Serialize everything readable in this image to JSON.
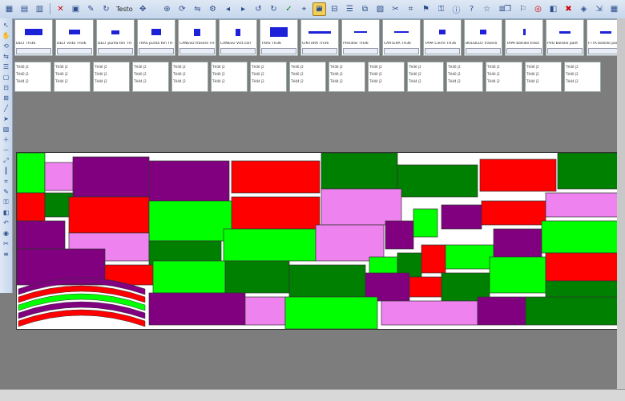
{
  "toolbar": {
    "text_label": "Testo"
  },
  "pieces": [
    {
      "label": "DELT TH36",
      "w": 22,
      "h": 8
    },
    {
      "label": "DELT vista TH36",
      "w": 14,
      "h": 6
    },
    {
      "label": "DELT punta ten TH",
      "w": 10,
      "h": 5
    },
    {
      "label": "TRAS punta ten TH",
      "w": 12,
      "h": 8
    },
    {
      "label": "CANESU trasero TH",
      "w": 8,
      "h": 9
    },
    {
      "label": "CANESU Vist carr",
      "w": 6,
      "h": 9
    },
    {
      "label": "TRAS TH36",
      "w": 22,
      "h": 12
    },
    {
      "label": "CINTURA TH36",
      "w": 28,
      "h": 3
    },
    {
      "label": "Presillas TH36",
      "w": 16,
      "h": 2
    },
    {
      "label": "CARTERA TH36",
      "w": 18,
      "h": 2
    },
    {
      "label": "TAPA Cierre TH36",
      "w": 8,
      "h": 6
    },
    {
      "label": "BOLSILLO Trasero",
      "w": 8,
      "h": 6
    },
    {
      "label": "TAPA bolsillo trase",
      "w": 3,
      "h": 8
    },
    {
      "label": "PVO bolsillo pant",
      "w": 14,
      "h": 3
    },
    {
      "label": "FTTA bolsillo pant",
      "w": 14,
      "h": 3
    }
  ],
  "stats_rows": [
    "TH36 |2",
    "TH40 |2",
    "TH44 |2"
  ],
  "colors": {
    "green": "#008000",
    "lime": "#00ff00",
    "red": "#ff0000",
    "purple": "#800080",
    "pink": "#ee82ee"
  }
}
